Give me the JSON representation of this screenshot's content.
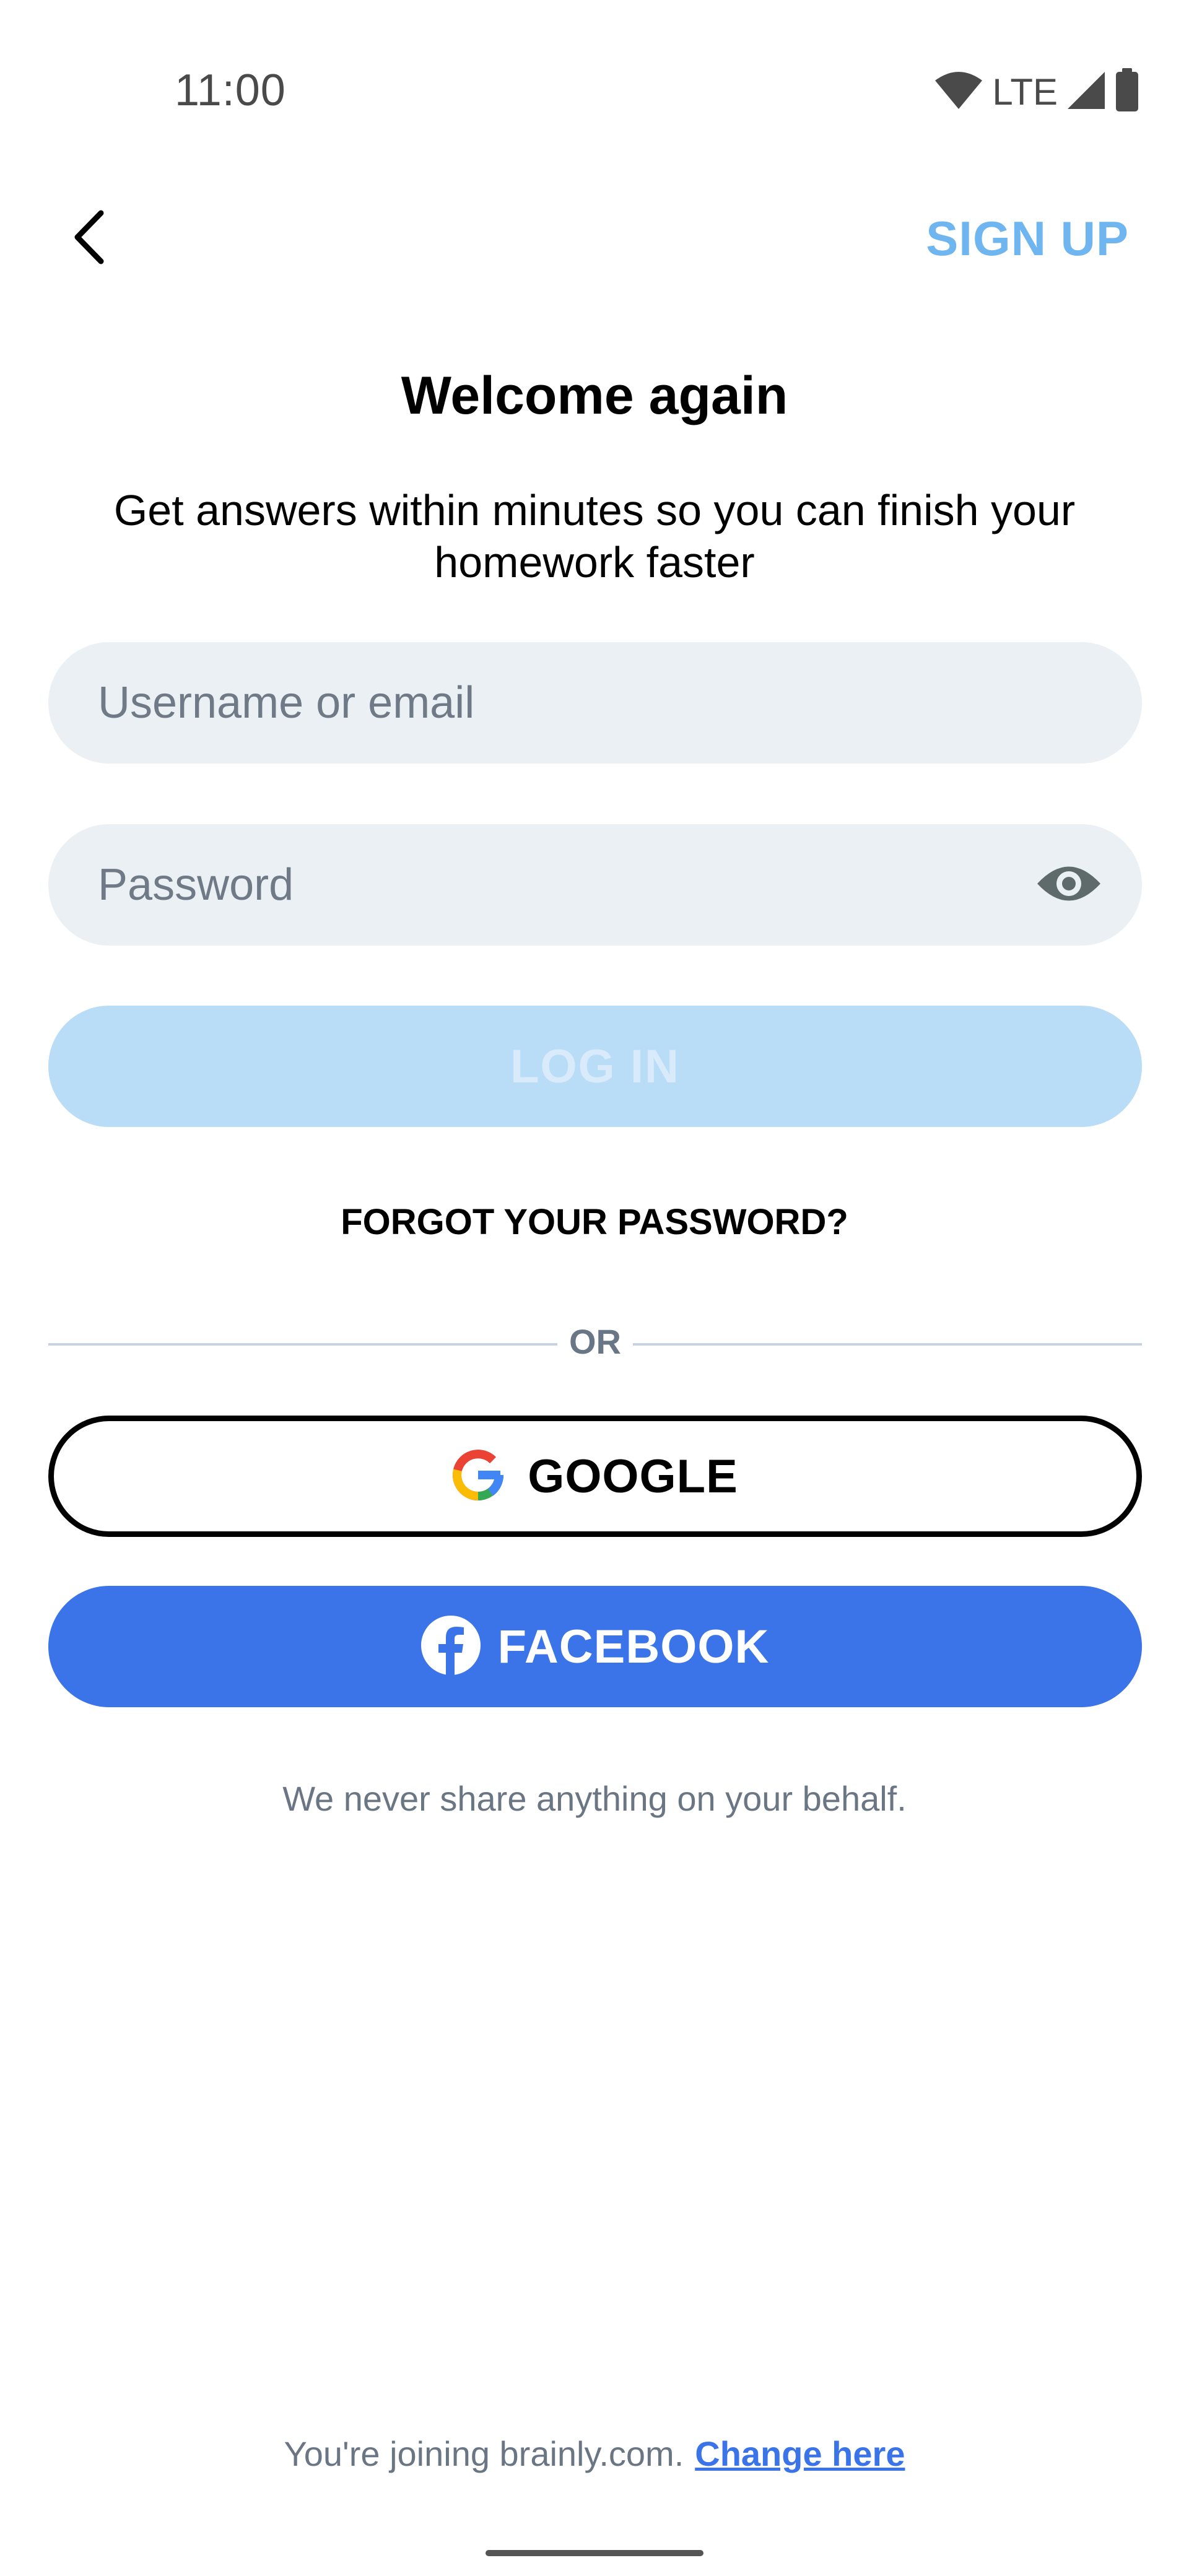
{
  "status_bar": {
    "time": "11:00",
    "network": "LTE",
    "icons": [
      "wifi-icon",
      "cellular-signal-icon",
      "battery-icon"
    ]
  },
  "header": {
    "back_icon": "chevron-left-icon",
    "signup_label": "SIGN UP"
  },
  "welcome": {
    "title": "Welcome again",
    "subtitle": "Get answers within minutes so you can finish your homework faster"
  },
  "form": {
    "username_placeholder": "Username or email",
    "password_placeholder": "Password",
    "password_toggle_icon": "eye-icon",
    "login_label": "LOG IN",
    "forgot_label": "FORGOT YOUR PASSWORD?"
  },
  "divider": {
    "label": "OR"
  },
  "social": {
    "google_label": "GOOGLE",
    "google_icon": "google-logo-icon",
    "facebook_label": "FACEBOOK",
    "facebook_icon": "facebook-logo-icon",
    "privacy_note": "We never share anything on your behalf."
  },
  "footer": {
    "joining_text": "You're joining brainly.com.",
    "change_link": "Change here"
  },
  "colors": {
    "accent_blue": "#3a74e8",
    "signup_blue": "#6fb5ef",
    "login_disabled": "#b9dcf7",
    "input_bg": "#ebf0f4"
  }
}
